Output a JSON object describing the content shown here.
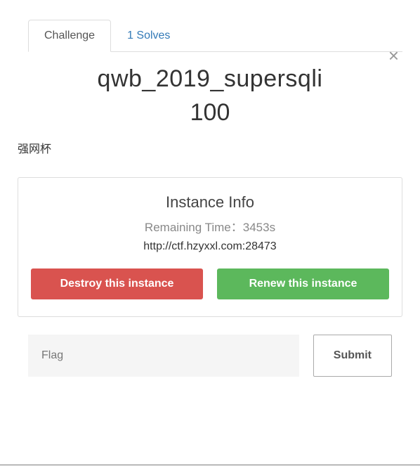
{
  "modal": {
    "close_label": "×"
  },
  "tabs": {
    "challenge": "Challenge",
    "solves": "1 Solves"
  },
  "challenge": {
    "title": "qwb_2019_supersqli",
    "points": "100",
    "category": "强网杯"
  },
  "instance": {
    "heading": "Instance Info",
    "remaining_label": "Remaining Time：",
    "remaining_value": "3453s",
    "url": "http://ctf.hzyxxl.com:28473",
    "destroy_label": "Destroy this instance",
    "renew_label": "Renew this instance"
  },
  "flag": {
    "placeholder": "Flag",
    "submit_label": "Submit"
  }
}
